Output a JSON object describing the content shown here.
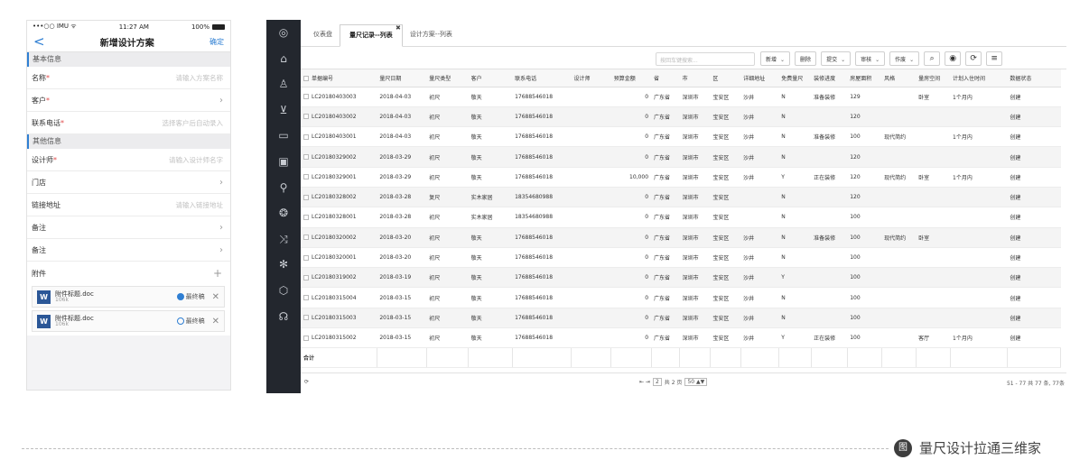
{
  "phone": {
    "status": {
      "carrier": "•••○○ IMU ᯤ",
      "time": "11:27 AM",
      "battery": "100%"
    },
    "nav": {
      "back": "<",
      "title": "新增设计方案",
      "confirm": "确定"
    },
    "sections": [
      {
        "title": "基本信息",
        "rows": [
          {
            "label": "名称",
            "required": "*",
            "value": "请输入方案名称",
            "kind": "input"
          },
          {
            "label": "客户",
            "required": "*",
            "value": "",
            "kind": "select"
          },
          {
            "label": "联系电话",
            "required": "*",
            "value": "选择客户后自动录入",
            "kind": "input"
          }
        ]
      },
      {
        "title": "其他信息",
        "rows": [
          {
            "label": "设计师",
            "required": "*",
            "value": "请输入设计师名字",
            "kind": "input"
          },
          {
            "label": "门店",
            "required": "",
            "value": "",
            "kind": "select"
          },
          {
            "label": "链接地址",
            "required": "",
            "value": "请输入链接地址",
            "kind": "input"
          },
          {
            "label": "备注",
            "required": "",
            "value": "",
            "kind": "select"
          },
          {
            "label": "备注",
            "required": "",
            "value": "",
            "kind": "select"
          }
        ]
      }
    ],
    "attachments": {
      "label": "附件",
      "items": [
        {
          "icon": "W",
          "name": "附件标题.doc",
          "size": "106k",
          "final_label": "最终稿",
          "is_final": true
        },
        {
          "icon": "W",
          "name": "附件标题.doc",
          "size": "106k",
          "final_label": "最终稿",
          "is_final": false
        }
      ]
    }
  },
  "desktop": {
    "sidebar_icons": [
      "compass-icon",
      "home-icon",
      "user-icon",
      "cart-icon",
      "inbox-icon",
      "briefcase-icon",
      "wrench-icon",
      "gear-icon",
      "shuffle-icon",
      "settings-icon",
      "shield-icon",
      "headset-icon"
    ],
    "tabs": [
      {
        "label": "仪表盘",
        "active": false
      },
      {
        "label": "量尺记录--列表",
        "active": true
      },
      {
        "label": "设计方案--列表",
        "active": false
      }
    ],
    "toolbar": {
      "search_placeholder": "按回车键搜索...",
      "buttons": [
        {
          "label": "新增",
          "caret": true
        },
        {
          "label": "删除",
          "caret": false
        },
        {
          "label": "提交",
          "caret": true
        },
        {
          "label": "审核",
          "caret": true
        },
        {
          "label": "作废",
          "caret": true
        }
      ]
    },
    "table": {
      "columns": [
        "单据编号",
        "量尺日期",
        "量尺类型",
        "客户",
        "联系电话",
        "设计师",
        "预算金额",
        "省",
        "市",
        "区",
        "详细地址",
        "免费量尺",
        "装修进度",
        "房屋面积",
        "风格",
        "量房空间",
        "计划入住时间",
        "数据状态"
      ],
      "rows": [
        [
          "LC20180403003",
          "2018-04-03",
          "初尺",
          "敬天",
          "17688546018",
          "",
          "0",
          "广东省",
          "深圳市",
          "宝安区",
          "沙井",
          "N",
          "准备装修",
          "129",
          "",
          "卧室",
          "1个月内",
          "创建"
        ],
        [
          "LC20180403002",
          "2018-04-03",
          "初尺",
          "敬天",
          "17688546018",
          "",
          "0",
          "广东省",
          "深圳市",
          "宝安区",
          "沙井",
          "N",
          "",
          "120",
          "",
          "",
          "",
          "创建"
        ],
        [
          "LC20180403001",
          "2018-04-03",
          "初尺",
          "敬天",
          "17688546018",
          "",
          "0",
          "广东省",
          "深圳市",
          "宝安区",
          "沙井",
          "N",
          "准备装修",
          "100",
          "现代简约",
          "",
          "1个月内",
          "创建"
        ],
        [
          "LC20180329002",
          "2018-03-29",
          "初尺",
          "敬天",
          "17688546018",
          "",
          "0",
          "广东省",
          "深圳市",
          "宝安区",
          "沙井",
          "N",
          "",
          "120",
          "",
          "",
          "",
          "创建"
        ],
        [
          "LC20180329001",
          "2018-03-29",
          "初尺",
          "敬天",
          "17688546018",
          "",
          "10,000",
          "广东省",
          "深圳市",
          "宝安区",
          "沙井",
          "Y",
          "正在装修",
          "120",
          "现代简约",
          "卧室",
          "1个月内",
          "创建"
        ],
        [
          "LC20180328002",
          "2018-03-28",
          "复尺",
          "实木家居",
          "18354680988",
          "",
          "0",
          "广东省",
          "深圳市",
          "宝安区",
          "",
          "N",
          "",
          "120",
          "",
          "",
          "",
          "创建"
        ],
        [
          "LC20180328001",
          "2018-03-28",
          "初尺",
          "实木家居",
          "18354680988",
          "",
          "0",
          "广东省",
          "深圳市",
          "宝安区",
          "",
          "N",
          "",
          "100",
          "",
          "",
          "",
          "创建"
        ],
        [
          "LC20180320002",
          "2018-03-20",
          "初尺",
          "敬天",
          "17688546018",
          "",
          "0",
          "广东省",
          "深圳市",
          "宝安区",
          "沙井",
          "N",
          "准备装修",
          "100",
          "现代简约",
          "卧室",
          "",
          "创建"
        ],
        [
          "LC20180320001",
          "2018-03-20",
          "初尺",
          "敬天",
          "17688546018",
          "",
          "0",
          "广东省",
          "深圳市",
          "宝安区",
          "沙井",
          "N",
          "",
          "100",
          "",
          "",
          "",
          "创建"
        ],
        [
          "LC20180319002",
          "2018-03-19",
          "初尺",
          "敬天",
          "17688546018",
          "",
          "0",
          "广东省",
          "深圳市",
          "宝安区",
          "沙井",
          "Y",
          "",
          "100",
          "",
          "",
          "",
          "创建"
        ],
        [
          "LC20180315004",
          "2018-03-15",
          "初尺",
          "敬天",
          "17688546018",
          "",
          "0",
          "广东省",
          "深圳市",
          "宝安区",
          "沙井",
          "N",
          "",
          "100",
          "",
          "",
          "",
          "创建"
        ],
        [
          "LC20180315003",
          "2018-03-15",
          "初尺",
          "敬天",
          "17688546018",
          "",
          "0",
          "广东省",
          "深圳市",
          "宝安区",
          "沙井",
          "N",
          "",
          "100",
          "",
          "",
          "",
          "创建"
        ],
        [
          "LC20180315002",
          "2018-03-15",
          "初尺",
          "敬天",
          "17688546018",
          "",
          "0",
          "广东省",
          "深圳市",
          "宝安区",
          "沙井",
          "Y",
          "正在装修",
          "100",
          "",
          "客厅",
          "1个月内",
          "创建"
        ]
      ],
      "footer_label": "合计"
    },
    "pager": {
      "nav": "⇤ ⇥",
      "page": "2",
      "total_pages": "共 2 页",
      "page_size": "50 ▲▼",
      "info": "51 - 77  共 77 条, 77条"
    }
  },
  "caption": {
    "icon": "图",
    "text": "量尺设计拉通三维家"
  }
}
